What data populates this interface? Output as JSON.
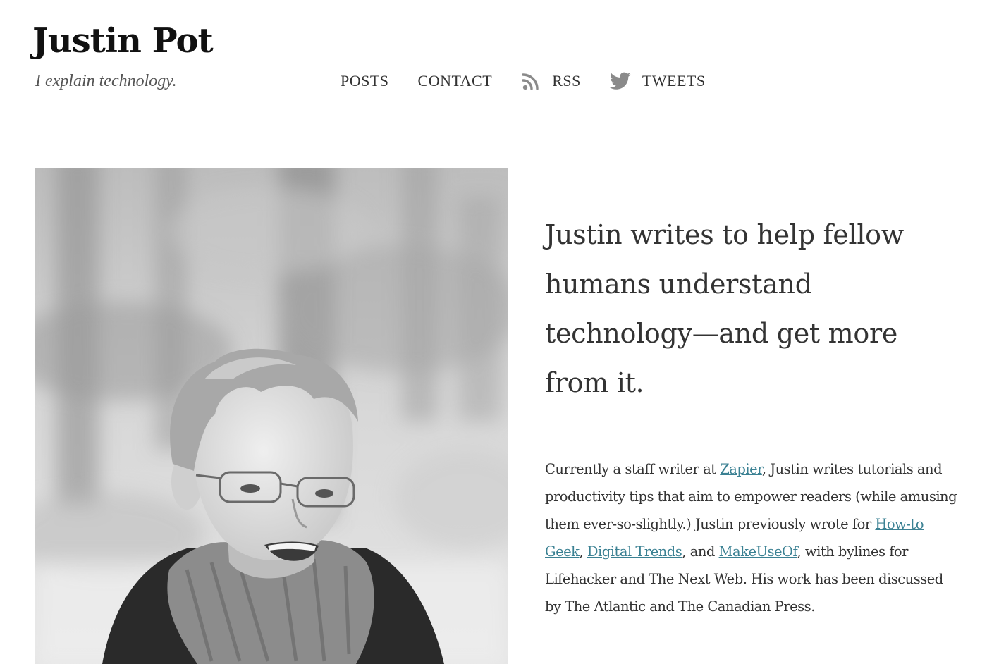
{
  "site": {
    "title": "Justin Pot",
    "tagline": "I explain technology."
  },
  "nav": {
    "posts": "POSTS",
    "contact": "CONTACT",
    "rss": "RSS",
    "tweets": "TWEETS",
    "rss_icon": "rss-icon",
    "twitter_icon": "twitter-bird-icon"
  },
  "hero": {
    "photo_subject": "portrait-photo",
    "headline": "Justin writes to help fellow humans understand technology—and get more from it."
  },
  "bio": {
    "p1": "Currently a staff writer at ",
    "link_zapier": "Zapier",
    "p2": ", Justin writes tutorials and productivity tips that aim to empower readers (while amusing them ever-so-slightly.) Justin previously wrote for ",
    "link_htg": "How-to Geek",
    "p3": ", ",
    "link_dt": "Digital Trends",
    "p4": ", and ",
    "link_muo": "MakeUseOf",
    "p5": ", with bylines for Lifehacker and The Next Web. His work has been discussed by The Atlantic and The Canadian Press."
  },
  "colors": {
    "link": "#3b8193",
    "text": "#333333",
    "title": "#111111"
  }
}
